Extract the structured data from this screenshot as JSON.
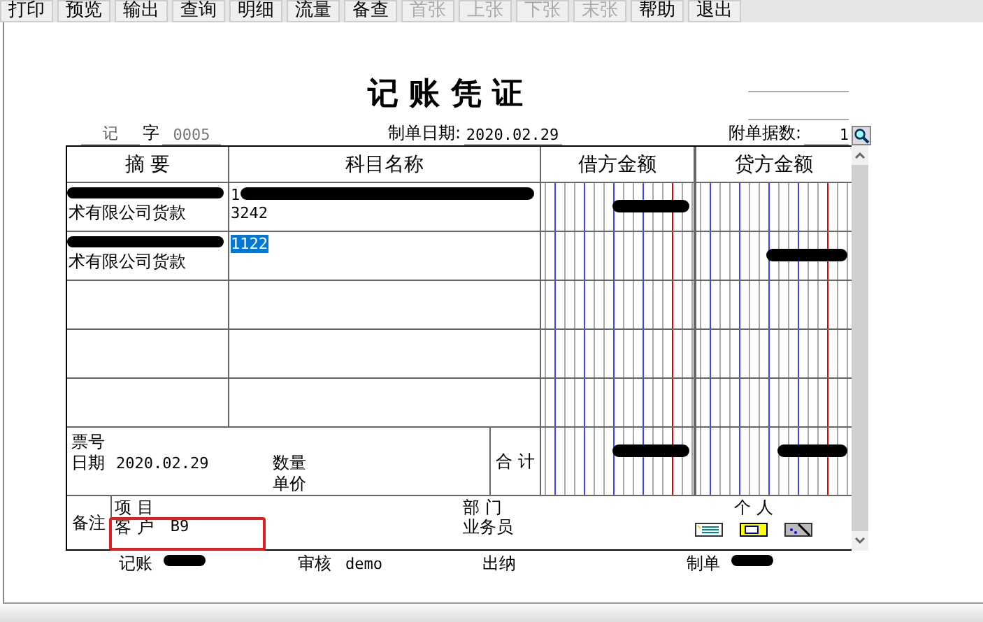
{
  "toolbar": [
    {
      "label": "打印",
      "disabled": false
    },
    {
      "label": "预览",
      "disabled": false
    },
    {
      "label": "输出",
      "disabled": false
    },
    {
      "label": "查询",
      "disabled": false
    },
    {
      "label": "明细",
      "disabled": false
    },
    {
      "label": "流量",
      "disabled": false
    },
    {
      "label": "备查",
      "disabled": false
    },
    {
      "label": "首张",
      "disabled": true
    },
    {
      "label": "上张",
      "disabled": true
    },
    {
      "label": "下张",
      "disabled": true
    },
    {
      "label": "末张",
      "disabled": true
    },
    {
      "label": "帮助",
      "disabled": false
    },
    {
      "label": "退出",
      "disabled": false
    }
  ],
  "voucher": {
    "title": "记 账 凭 证",
    "type": "记",
    "type_suffix": "字",
    "number": "0005",
    "date_label": "制单日期:",
    "date": "2020.02.29",
    "attachments_label": "附单据数:",
    "attachments": "1"
  },
  "table": {
    "columns": [
      "摘 要",
      "科目名称",
      "借方金额",
      "贷方金额"
    ],
    "rows": [
      {
        "summary": "术有限公司货款",
        "summary_redacted": true,
        "subject": [
          "1",
          "3242"
        ],
        "subject_redacted": true,
        "subject_selected": false,
        "debit_redacted": true,
        "credit_redacted": false
      },
      {
        "summary": "术有限公司货款",
        "summary_redacted": true,
        "subject": [
          "1122"
        ],
        "subject_redacted": false,
        "subject_selected": true,
        "debit_redacted": false,
        "credit_redacted": true
      },
      {
        "summary_redacted": false,
        "subject_redacted": false,
        "debit_redacted": false,
        "credit_redacted": false
      },
      {
        "summary_redacted": false,
        "subject_redacted": false,
        "debit_redacted": false,
        "credit_redacted": false
      },
      {
        "summary_redacted": false,
        "subject_redacted": false,
        "debit_redacted": false,
        "credit_redacted": false
      }
    ]
  },
  "summary": {
    "ticket_label": "票号",
    "date_label": "日期",
    "date": "2020.02.29",
    "quantity_label": "数量",
    "price_label": "单价",
    "total_label": "合 计",
    "total_debit_redacted": true,
    "total_credit_redacted": true
  },
  "notes": {
    "label": "备注",
    "project_label": "项 目",
    "customer_label": "客 户",
    "customer": "B9",
    "customer_highlighted": true,
    "department_label": "部 门",
    "salesperson_label": "业务员",
    "person_label": "个 人"
  },
  "signatures": [
    {
      "label": "记账",
      "value_redacted": true
    },
    {
      "label": "审核",
      "value": "demo",
      "value_redacted": false
    },
    {
      "label": "出纳",
      "value_redacted": false
    },
    {
      "label": "制单",
      "value_redacted": true
    }
  ]
}
